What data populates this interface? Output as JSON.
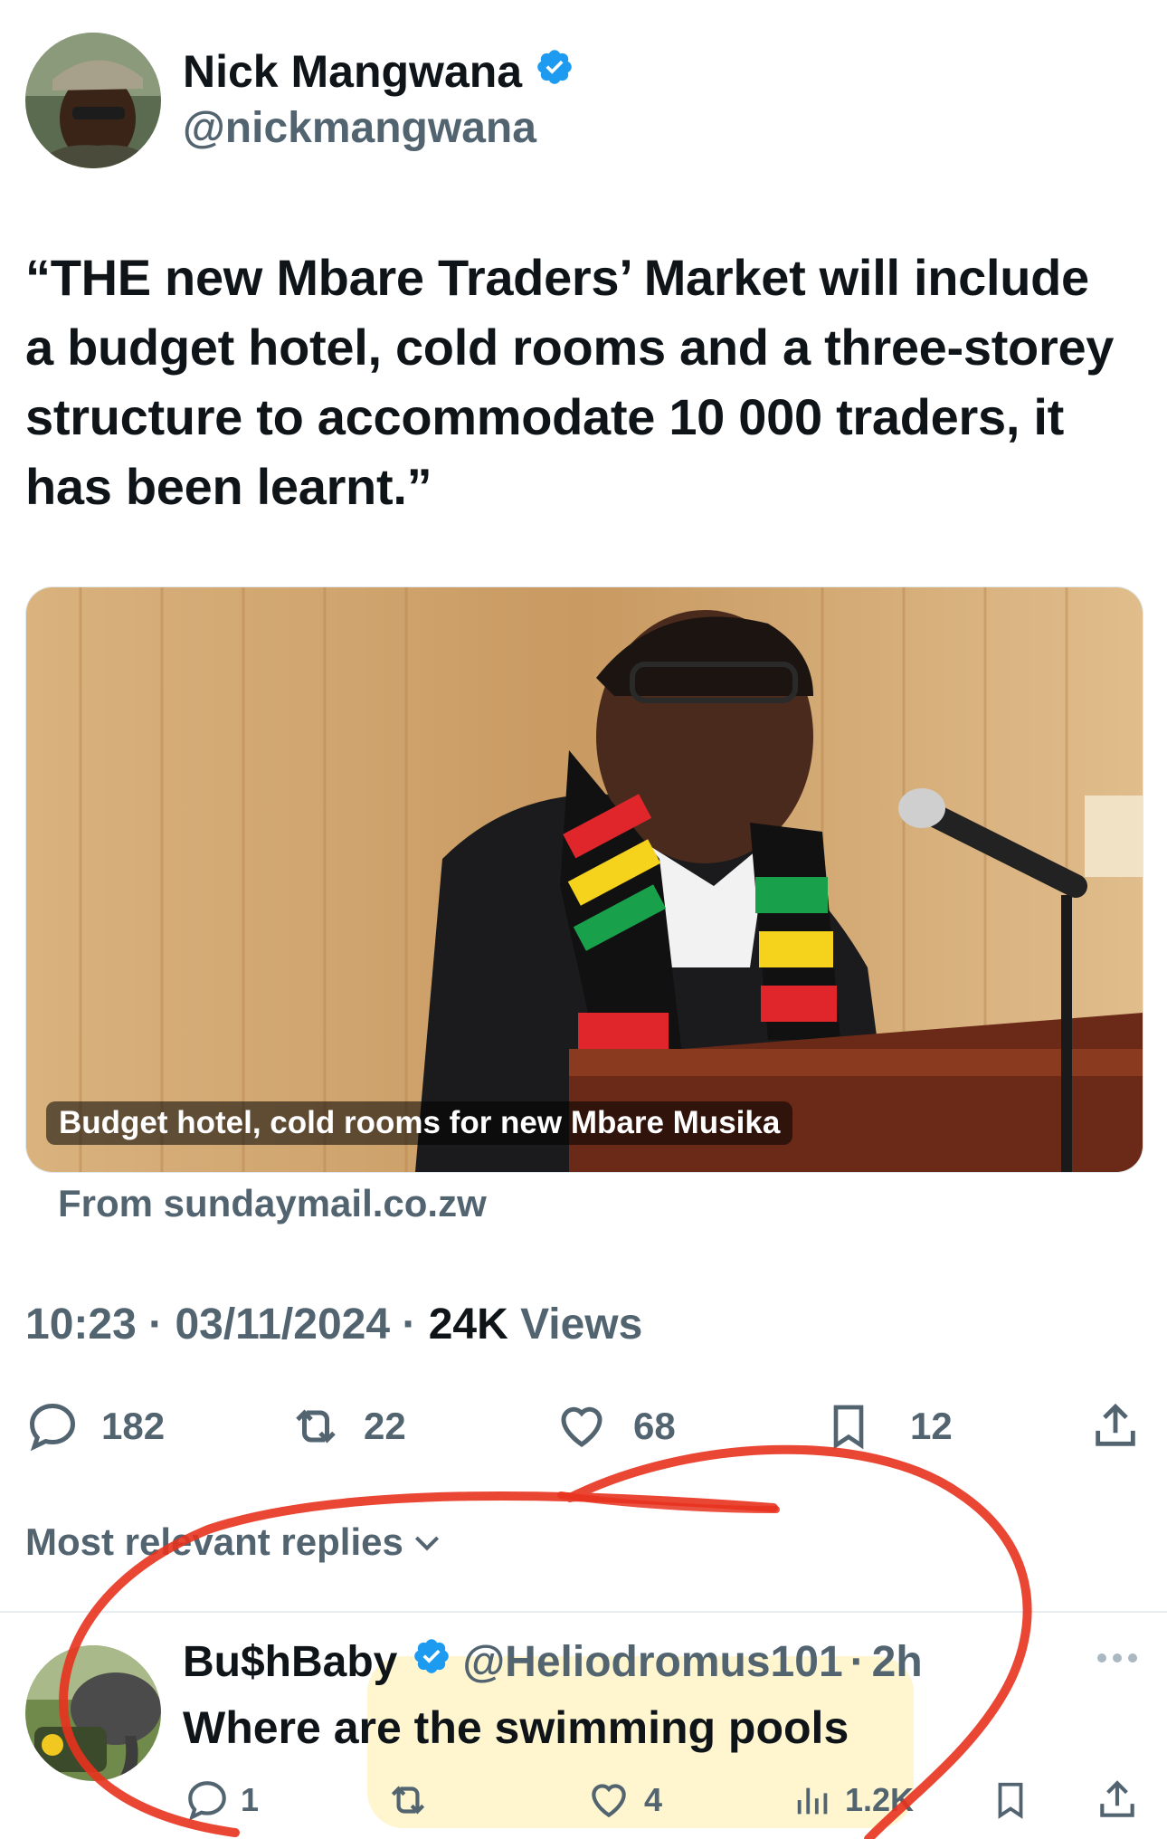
{
  "tweet": {
    "author_name": "Nick Mangwana",
    "author_handle": "@nickmangwana",
    "text": "“THE new Mbare Traders’ Market will include a budget hotel, cold rooms and a three-storey structure to accommodate 10 000 traders, it has been learnt.”",
    "card": {
      "caption": "Budget hotel, cold rooms for new Mbare Musika",
      "source": "From sundaymail.co.zw"
    },
    "time": "10:23",
    "date": "03/11/2024",
    "views_count": "24K",
    "views_label": "Views",
    "separator": "·",
    "stats": {
      "replies": "182",
      "reposts": "22",
      "likes": "68",
      "bookmarks": "12"
    }
  },
  "replies_header": "Most relevant replies",
  "reply": {
    "author_name": "Bu$hBaby",
    "author_handle": "@Heliodromus101",
    "time": "2h",
    "text": "Where are the swimming pools",
    "stats": {
      "replies": "1",
      "likes": "4",
      "views": "1.2K"
    }
  },
  "colors": {
    "verified": "#1d9bf0",
    "muted": "#536471",
    "annotation_red": "#e8321e"
  }
}
